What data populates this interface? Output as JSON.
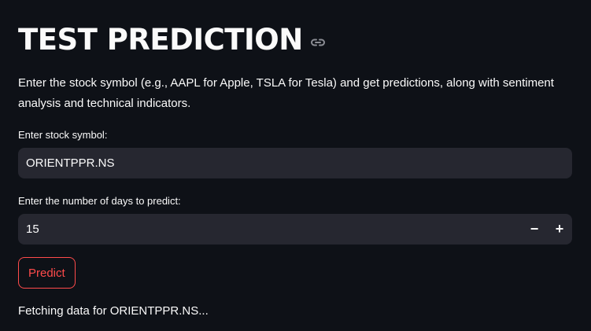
{
  "header": {
    "title": "TEST PREDICTION",
    "anchor_icon": "link-icon"
  },
  "intro": {
    "text": "Enter the stock symbol (e.g., AAPL for Apple, TSLA for Tesla) and get predictions, along with sentiment analysis and technical indicators."
  },
  "symbol_field": {
    "label": "Enter stock symbol:",
    "value": "ORIENTPPR.NS"
  },
  "days_field": {
    "label": "Enter the number of days to predict:",
    "value": "15",
    "decrement_label": "−",
    "increment_label": "+"
  },
  "predict_button": {
    "label": "Predict"
  },
  "status": {
    "text": "Fetching data for ORIENTPPR.NS..."
  },
  "colors": {
    "background": "#0e1117",
    "input_background": "#262730",
    "accent": "#ff4b4b",
    "text": "#fafafa"
  }
}
